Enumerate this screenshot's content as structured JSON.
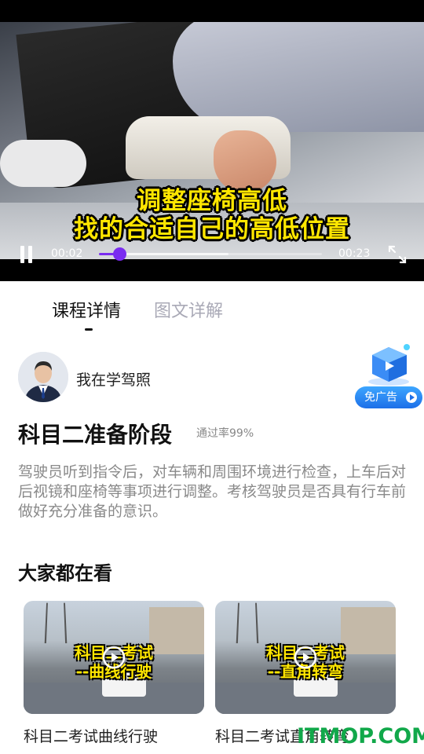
{
  "video": {
    "subtitle_line1": "调整座椅高低",
    "subtitle_line2": "找的合适自己的高低位置",
    "current_time": "00:02",
    "duration": "00:23",
    "progress_fraction": 0.09,
    "accent_color": "#7a2cf0",
    "icons": [
      "pause-icon",
      "fullscreen-icon"
    ]
  },
  "tabs": [
    {
      "label": "课程详情",
      "active": true
    },
    {
      "label": "图文详解",
      "active": false
    }
  ],
  "author": {
    "name": "我在学驾照"
  },
  "adfree": {
    "label": "免广告"
  },
  "lesson": {
    "title": "科目二准备阶段",
    "pass_rate": "通过率99%",
    "description": "驾驶员听到指令后，对车辆和周围环境进行检查，上车后对后视镜和座椅等事项进行调整。考核驾驶员是否具有行车前做好充分准备的意识。"
  },
  "related": {
    "title": "大家都在看",
    "items": [
      {
        "caption_line1": "科目二考试",
        "caption_line2": "--曲线行驶",
        "title": "科目二考试曲线行驶"
      },
      {
        "caption_line1": "科目二考试",
        "caption_line2": "--直角转弯",
        "title": "科目二考试直角转弯"
      }
    ]
  },
  "watermark": "ITMOP.COM"
}
